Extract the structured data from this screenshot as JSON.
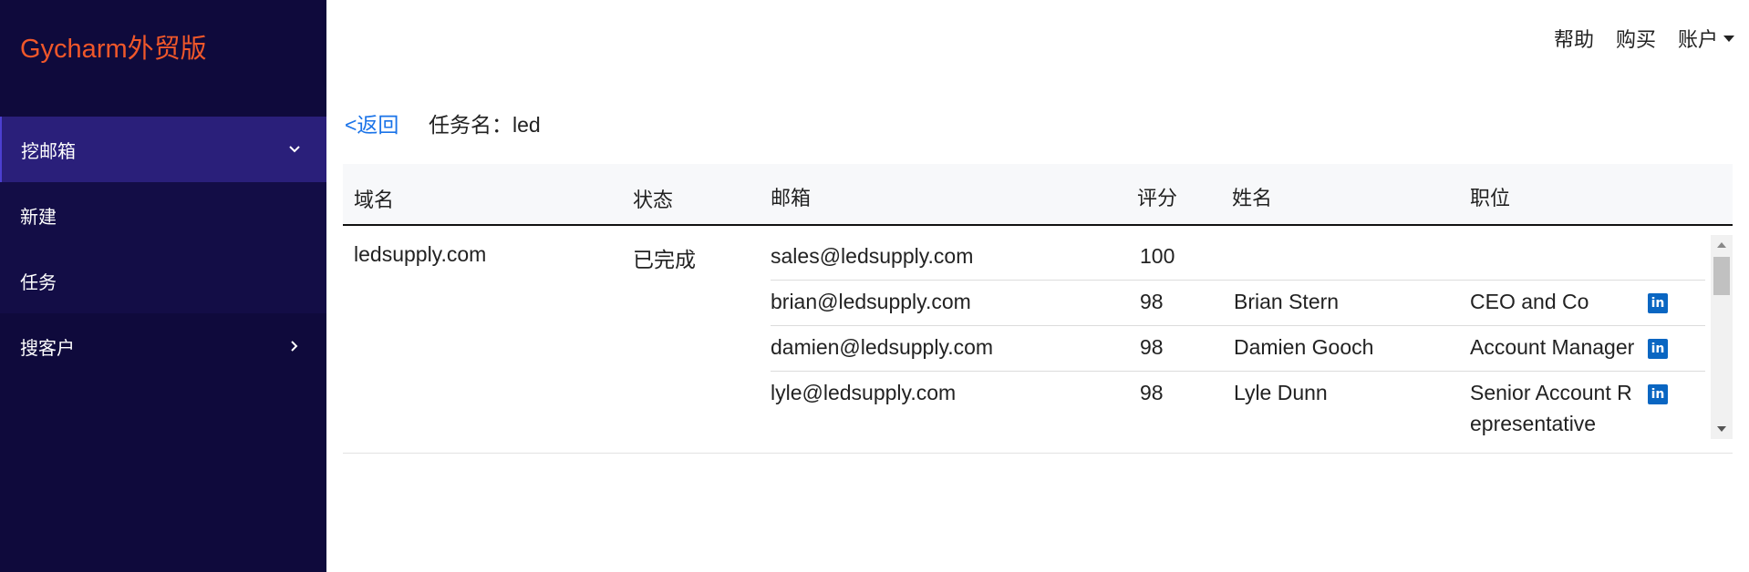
{
  "brand": {
    "logo_text": "Gycharm外贸版",
    "color": "#f0572a"
  },
  "sidebar": {
    "items": [
      {
        "label": "挖邮箱",
        "icon": "chevron-down-icon"
      },
      {
        "label": "新建"
      },
      {
        "label": "任务"
      },
      {
        "label": "搜客户",
        "icon": "chevron-right-icon"
      }
    ]
  },
  "topnav": {
    "help": "帮助",
    "buy": "购买",
    "account": "账户"
  },
  "page": {
    "back": "<返回",
    "task_prefix": "任务名：",
    "task_name": "led"
  },
  "table": {
    "headers": [
      "域名",
      "状态",
      "邮箱",
      "评分",
      "姓名",
      "职位"
    ],
    "domain": "ledsupply.com",
    "status": "已完成",
    "rows": [
      {
        "email": "sales@ledsupply.com",
        "score": "100",
        "name": "",
        "title": "",
        "linkedin": false
      },
      {
        "email": "brian@ledsupply.com",
        "score": "98",
        "name": "Brian Stern",
        "title": "CEO and Co",
        "linkedin": true
      },
      {
        "email": "damien@ledsupply.com",
        "score": "98",
        "name": "Damien Gooch",
        "title": "Account Manager",
        "linkedin": true
      },
      {
        "email": "lyle@ledsupply.com",
        "score": "98",
        "name": "Lyle Dunn",
        "title": "Senior Account R",
        "title2": "epresentative",
        "linkedin": true
      }
    ]
  }
}
